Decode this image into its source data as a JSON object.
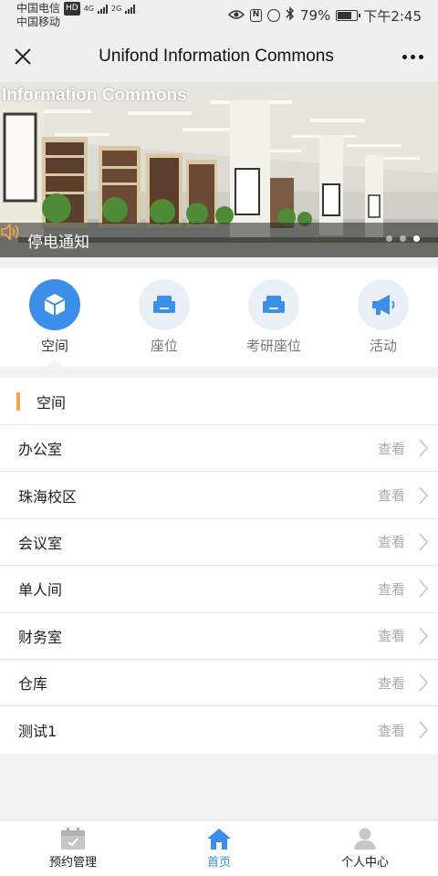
{
  "status_bar": {
    "carrier1": "中国电信",
    "carrier1_badge": "HD",
    "carrier2": "中国移动",
    "net1": "4G",
    "net2": "2G",
    "battery": "79%",
    "time": "下午2:45",
    "battery_level": 0.79
  },
  "header": {
    "title": "Unifond Information Commons"
  },
  "banner": {
    "title": "Information Commons",
    "notice": "停电通知",
    "slide_count": 3,
    "active_slide": 3
  },
  "categories": [
    {
      "label": "空间",
      "icon": "cube-icon",
      "active": true
    },
    {
      "label": "座位",
      "icon": "armchair-icon",
      "active": false
    },
    {
      "label": "考研座位",
      "icon": "armchair-icon",
      "active": false
    },
    {
      "label": "活动",
      "icon": "megaphone-icon",
      "active": false
    }
  ],
  "section": {
    "title": "空间",
    "accent_color": "#f0a642",
    "view_label": "查看",
    "items": [
      {
        "name": "办公室"
      },
      {
        "name": "珠海校区"
      },
      {
        "name": "会议室"
      },
      {
        "name": "单人间"
      },
      {
        "name": "财务室"
      },
      {
        "name": "仓库"
      },
      {
        "name": "测试1"
      }
    ]
  },
  "tabbar": {
    "tabs": [
      {
        "label": "预约管理",
        "icon": "calendar-icon",
        "active": false
      },
      {
        "label": "首页",
        "icon": "home-icon",
        "active": true
      },
      {
        "label": "个人中心",
        "icon": "user-icon",
        "active": false
      }
    ]
  },
  "colors": {
    "primary": "#3b8fe8",
    "accent": "#f0a642"
  }
}
